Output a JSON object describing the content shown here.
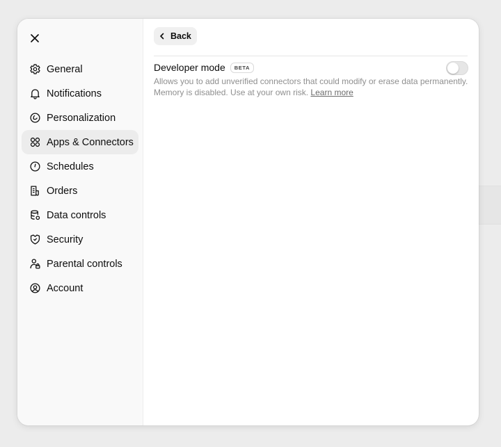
{
  "sidebar": {
    "items": [
      {
        "label": "General",
        "icon": "gear-icon"
      },
      {
        "label": "Notifications",
        "icon": "bell-icon"
      },
      {
        "label": "Personalization",
        "icon": "personalization-icon"
      },
      {
        "label": "Apps & Connectors",
        "icon": "apps-icon",
        "active": true
      },
      {
        "label": "Schedules",
        "icon": "clock-icon"
      },
      {
        "label": "Orders",
        "icon": "receipt-icon"
      },
      {
        "label": "Data controls",
        "icon": "database-icon"
      },
      {
        "label": "Security",
        "icon": "shield-icon"
      },
      {
        "label": "Parental controls",
        "icon": "parental-icon"
      },
      {
        "label": "Account",
        "icon": "user-circle-icon"
      }
    ]
  },
  "main": {
    "back_label": "Back",
    "developer_mode": {
      "title": "Developer mode",
      "badge": "BETA",
      "description": "Allows you to add unverified connectors that could modify or erase data permanently. Memory is disabled. Use at your own risk.",
      "learn_more": "Learn more",
      "enabled": false
    }
  },
  "colors": {
    "active_item_bg": "#ececec",
    "sidebar_bg": "#f9f9f9",
    "muted_text": "#8f8f8f"
  }
}
